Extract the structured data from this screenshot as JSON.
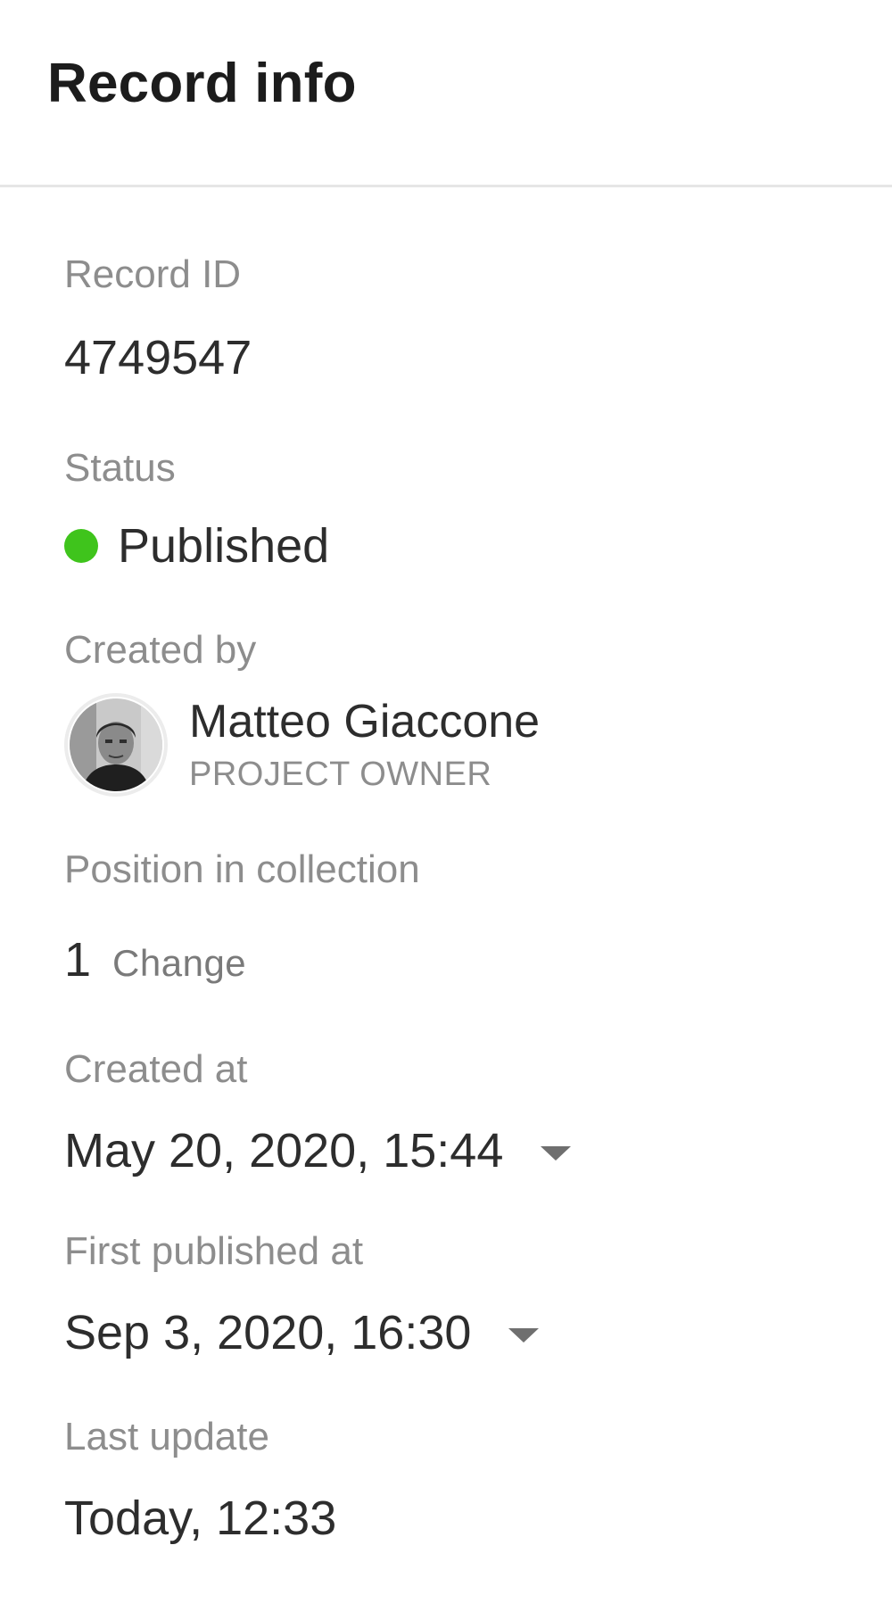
{
  "header": {
    "title": "Record info"
  },
  "fields": {
    "record_id": {
      "label": "Record ID",
      "value": "4749547"
    },
    "status": {
      "label": "Status",
      "value": "Published",
      "color": "#3fc41c"
    },
    "created_by": {
      "label": "Created by",
      "name": "Matteo Giaccone",
      "role": "PROJECT OWNER",
      "avatar_icon": "user-avatar-photo"
    },
    "position": {
      "label": "Position in collection",
      "value": "1",
      "change_label": "Change"
    },
    "created_at": {
      "label": "Created at",
      "value": "May 20, 2020, 15:44",
      "icon": "caret-down-icon"
    },
    "first_published_at": {
      "label": "First published at",
      "value": "Sep 3, 2020, 16:30",
      "icon": "caret-down-icon"
    },
    "last_update": {
      "label": "Last update",
      "value": "Today, 12:33"
    }
  }
}
